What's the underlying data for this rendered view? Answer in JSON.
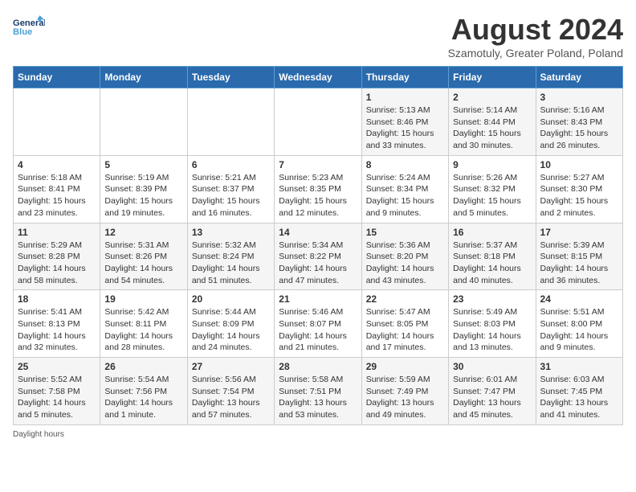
{
  "header": {
    "month": "August 2024",
    "location": "Szamotuly, Greater Poland, Poland",
    "logo_line1": "General",
    "logo_line2": "Blue"
  },
  "weekdays": [
    "Sunday",
    "Monday",
    "Tuesday",
    "Wednesday",
    "Thursday",
    "Friday",
    "Saturday"
  ],
  "weeks": [
    [
      {
        "day": "",
        "sunrise": "",
        "sunset": "",
        "daylight": ""
      },
      {
        "day": "",
        "sunrise": "",
        "sunset": "",
        "daylight": ""
      },
      {
        "day": "",
        "sunrise": "",
        "sunset": "",
        "daylight": ""
      },
      {
        "day": "",
        "sunrise": "",
        "sunset": "",
        "daylight": ""
      },
      {
        "day": "1",
        "sunrise": "Sunrise: 5:13 AM",
        "sunset": "Sunset: 8:46 PM",
        "daylight": "Daylight: 15 hours and 33 minutes."
      },
      {
        "day": "2",
        "sunrise": "Sunrise: 5:14 AM",
        "sunset": "Sunset: 8:44 PM",
        "daylight": "Daylight: 15 hours and 30 minutes."
      },
      {
        "day": "3",
        "sunrise": "Sunrise: 5:16 AM",
        "sunset": "Sunset: 8:43 PM",
        "daylight": "Daylight: 15 hours and 26 minutes."
      }
    ],
    [
      {
        "day": "4",
        "sunrise": "Sunrise: 5:18 AM",
        "sunset": "Sunset: 8:41 PM",
        "daylight": "Daylight: 15 hours and 23 minutes."
      },
      {
        "day": "5",
        "sunrise": "Sunrise: 5:19 AM",
        "sunset": "Sunset: 8:39 PM",
        "daylight": "Daylight: 15 hours and 19 minutes."
      },
      {
        "day": "6",
        "sunrise": "Sunrise: 5:21 AM",
        "sunset": "Sunset: 8:37 PM",
        "daylight": "Daylight: 15 hours and 16 minutes."
      },
      {
        "day": "7",
        "sunrise": "Sunrise: 5:23 AM",
        "sunset": "Sunset: 8:35 PM",
        "daylight": "Daylight: 15 hours and 12 minutes."
      },
      {
        "day": "8",
        "sunrise": "Sunrise: 5:24 AM",
        "sunset": "Sunset: 8:34 PM",
        "daylight": "Daylight: 15 hours and 9 minutes."
      },
      {
        "day": "9",
        "sunrise": "Sunrise: 5:26 AM",
        "sunset": "Sunset: 8:32 PM",
        "daylight": "Daylight: 15 hours and 5 minutes."
      },
      {
        "day": "10",
        "sunrise": "Sunrise: 5:27 AM",
        "sunset": "Sunset: 8:30 PM",
        "daylight": "Daylight: 15 hours and 2 minutes."
      }
    ],
    [
      {
        "day": "11",
        "sunrise": "Sunrise: 5:29 AM",
        "sunset": "Sunset: 8:28 PM",
        "daylight": "Daylight: 14 hours and 58 minutes."
      },
      {
        "day": "12",
        "sunrise": "Sunrise: 5:31 AM",
        "sunset": "Sunset: 8:26 PM",
        "daylight": "Daylight: 14 hours and 54 minutes."
      },
      {
        "day": "13",
        "sunrise": "Sunrise: 5:32 AM",
        "sunset": "Sunset: 8:24 PM",
        "daylight": "Daylight: 14 hours and 51 minutes."
      },
      {
        "day": "14",
        "sunrise": "Sunrise: 5:34 AM",
        "sunset": "Sunset: 8:22 PM",
        "daylight": "Daylight: 14 hours and 47 minutes."
      },
      {
        "day": "15",
        "sunrise": "Sunrise: 5:36 AM",
        "sunset": "Sunset: 8:20 PM",
        "daylight": "Daylight: 14 hours and 43 minutes."
      },
      {
        "day": "16",
        "sunrise": "Sunrise: 5:37 AM",
        "sunset": "Sunset: 8:18 PM",
        "daylight": "Daylight: 14 hours and 40 minutes."
      },
      {
        "day": "17",
        "sunrise": "Sunrise: 5:39 AM",
        "sunset": "Sunset: 8:15 PM",
        "daylight": "Daylight: 14 hours and 36 minutes."
      }
    ],
    [
      {
        "day": "18",
        "sunrise": "Sunrise: 5:41 AM",
        "sunset": "Sunset: 8:13 PM",
        "daylight": "Daylight: 14 hours and 32 minutes."
      },
      {
        "day": "19",
        "sunrise": "Sunrise: 5:42 AM",
        "sunset": "Sunset: 8:11 PM",
        "daylight": "Daylight: 14 hours and 28 minutes."
      },
      {
        "day": "20",
        "sunrise": "Sunrise: 5:44 AM",
        "sunset": "Sunset: 8:09 PM",
        "daylight": "Daylight: 14 hours and 24 minutes."
      },
      {
        "day": "21",
        "sunrise": "Sunrise: 5:46 AM",
        "sunset": "Sunset: 8:07 PM",
        "daylight": "Daylight: 14 hours and 21 minutes."
      },
      {
        "day": "22",
        "sunrise": "Sunrise: 5:47 AM",
        "sunset": "Sunset: 8:05 PM",
        "daylight": "Daylight: 14 hours and 17 minutes."
      },
      {
        "day": "23",
        "sunrise": "Sunrise: 5:49 AM",
        "sunset": "Sunset: 8:03 PM",
        "daylight": "Daylight: 14 hours and 13 minutes."
      },
      {
        "day": "24",
        "sunrise": "Sunrise: 5:51 AM",
        "sunset": "Sunset: 8:00 PM",
        "daylight": "Daylight: 14 hours and 9 minutes."
      }
    ],
    [
      {
        "day": "25",
        "sunrise": "Sunrise: 5:52 AM",
        "sunset": "Sunset: 7:58 PM",
        "daylight": "Daylight: 14 hours and 5 minutes."
      },
      {
        "day": "26",
        "sunrise": "Sunrise: 5:54 AM",
        "sunset": "Sunset: 7:56 PM",
        "daylight": "Daylight: 14 hours and 1 minute."
      },
      {
        "day": "27",
        "sunrise": "Sunrise: 5:56 AM",
        "sunset": "Sunset: 7:54 PM",
        "daylight": "Daylight: 13 hours and 57 minutes."
      },
      {
        "day": "28",
        "sunrise": "Sunrise: 5:58 AM",
        "sunset": "Sunset: 7:51 PM",
        "daylight": "Daylight: 13 hours and 53 minutes."
      },
      {
        "day": "29",
        "sunrise": "Sunrise: 5:59 AM",
        "sunset": "Sunset: 7:49 PM",
        "daylight": "Daylight: 13 hours and 49 minutes."
      },
      {
        "day": "30",
        "sunrise": "Sunrise: 6:01 AM",
        "sunset": "Sunset: 7:47 PM",
        "daylight": "Daylight: 13 hours and 45 minutes."
      },
      {
        "day": "31",
        "sunrise": "Sunrise: 6:03 AM",
        "sunset": "Sunset: 7:45 PM",
        "daylight": "Daylight: 13 hours and 41 minutes."
      }
    ]
  ],
  "footer": "Daylight hours"
}
